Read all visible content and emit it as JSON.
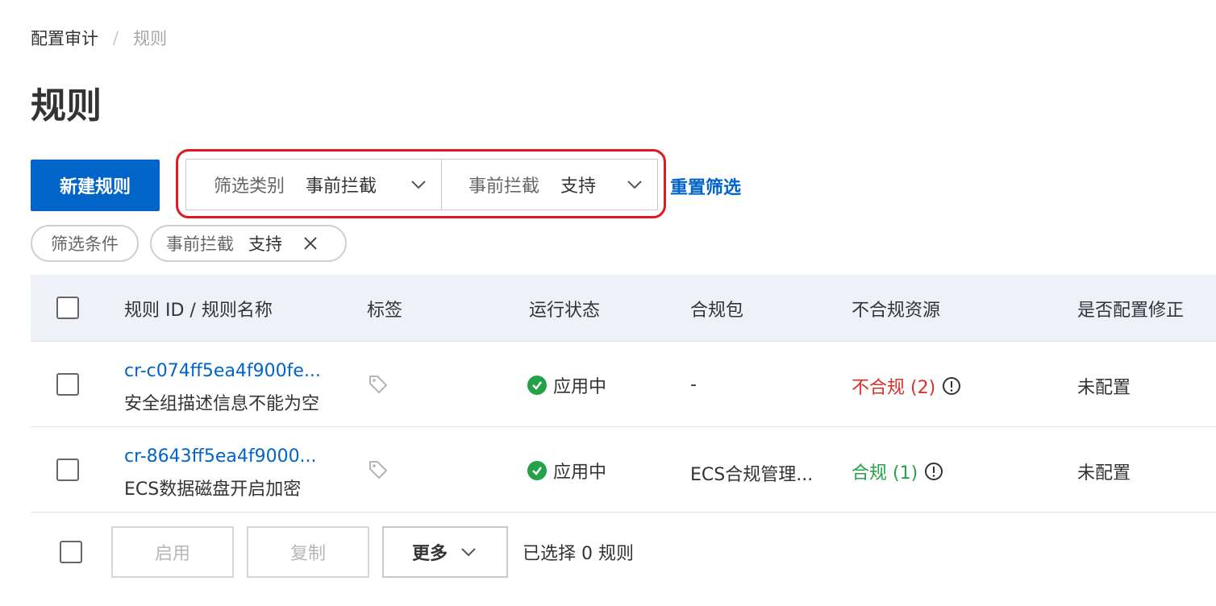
{
  "breadcrumb": {
    "root": "配置审计",
    "separator": "/",
    "current": "规则"
  },
  "page_title": "规则",
  "toolbar": {
    "new_rule_label": "新建规则",
    "filter_category": {
      "label": "筛选类别",
      "value": "事前拦截"
    },
    "filter_value": {
      "label": "事前拦截",
      "value": "支持"
    },
    "reset_label": "重置筛选"
  },
  "filter_tags": {
    "conditions_label": "筛选条件",
    "active_key": "事前拦截",
    "active_value": "支持"
  },
  "table": {
    "columns": [
      "规则 ID / 规则名称",
      "标签",
      "运行状态",
      "合规包",
      "不合规资源",
      "是否配置修正"
    ],
    "rows": [
      {
        "rule_id": "cr-c074ff5ea4f900fe...",
        "rule_name": "安全组描述信息不能为空",
        "status": "应用中",
        "package": "-",
        "compliance": "不合规 (2)",
        "compliance_state": "noncompliant",
        "remediation": "未配置"
      },
      {
        "rule_id": "cr-8643ff5ea4f9000...",
        "rule_name": "ECS数据磁盘开启加密",
        "status": "应用中",
        "package": "ECS合规管理...",
        "compliance": "合规 (1)",
        "compliance_state": "compliant",
        "remediation": "未配置"
      }
    ]
  },
  "footer": {
    "enable_label": "启用",
    "copy_label": "复制",
    "more_label": "更多",
    "selected_text": "已选择 0 规则"
  },
  "colors": {
    "primary": "#0064c8",
    "success": "#23a249",
    "danger": "#d93026",
    "highlight": "#e0191f",
    "header_bg": "#eef1f8"
  },
  "icons": [
    "chevron-down-icon",
    "close-icon",
    "tag-icon",
    "check-circle-icon",
    "info-icon"
  ]
}
